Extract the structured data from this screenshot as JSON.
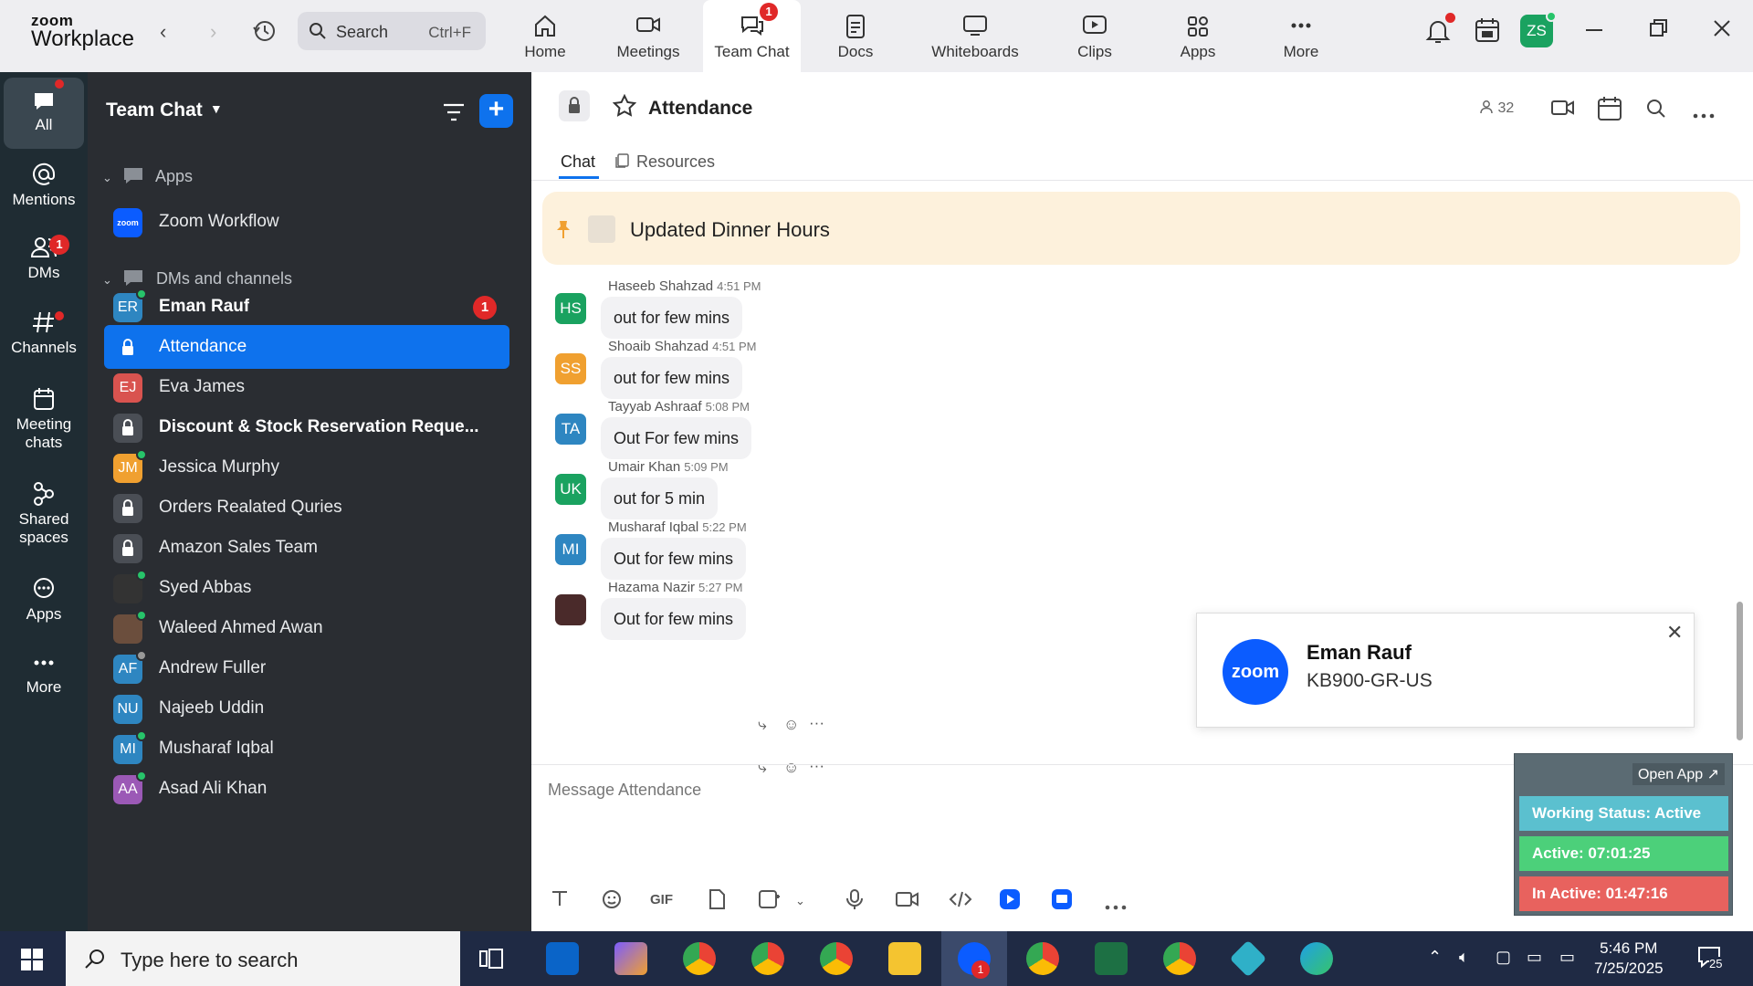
{
  "app": {
    "logo_line1": "zoom",
    "logo_line2": "Workplace"
  },
  "topbar": {
    "back_glyph": "‹",
    "forward_glyph": "›",
    "search": {
      "label": "Search",
      "shortcut": "Ctrl+F"
    },
    "tabs": [
      {
        "label": "Home",
        "icon": "home-icon"
      },
      {
        "label": "Meetings",
        "icon": "video-camera-icon"
      },
      {
        "label": "Team Chat",
        "icon": "chat-bubbles-icon",
        "badge": "1",
        "active": true
      },
      {
        "label": "Docs",
        "icon": "document-icon"
      },
      {
        "label": "Whiteboards",
        "icon": "whiteboard-icon"
      },
      {
        "label": "Clips",
        "icon": "clips-icon"
      },
      {
        "label": "Apps",
        "icon": "apps-grid-icon"
      },
      {
        "label": "More",
        "icon": "more-dots-icon"
      }
    ],
    "user_initials": "ZS"
  },
  "rail": {
    "items": [
      {
        "label": "All",
        "icon": "chat-icon",
        "active": true,
        "dot": true
      },
      {
        "label": "Mentions",
        "icon": "at-icon"
      },
      {
        "label": "DMs",
        "icon": "people-icon",
        "badge": "1"
      },
      {
        "label": "Channels",
        "icon": "hash-icon",
        "dot": true
      },
      {
        "label": "Meeting chats",
        "icon": "calendar-icon"
      },
      {
        "label": "Shared spaces",
        "icon": "shared-spaces-icon"
      },
      {
        "label": "Apps",
        "icon": "apps-chat-icon"
      },
      {
        "label": "More",
        "icon": "more-dots-icon"
      }
    ]
  },
  "panel": {
    "title": "Team Chat",
    "section_apps": "Apps",
    "zoom_workflow": {
      "label": "Zoom Workflow",
      "avatar": "zoom"
    },
    "section_dms": "DMs and channels",
    "rows": [
      {
        "name": "Eman Rauf",
        "initials": "ER",
        "color": "#2e86c1",
        "bold": true,
        "count": "1",
        "status": "online"
      },
      {
        "name": "Attendance",
        "locked": true,
        "selected": true
      },
      {
        "name": "Eva James",
        "initials": "EJ",
        "color": "#d9534f"
      },
      {
        "name": "Discount & Stock Reservation Reque...",
        "locked": true,
        "bold": true
      },
      {
        "name": "Jessica Murphy",
        "initials": "JM",
        "color": "#f0a030",
        "status": "online"
      },
      {
        "name": "Orders Realated Quries",
        "locked": true
      },
      {
        "name": "Amazon Sales Team",
        "locked": true
      },
      {
        "name": "Syed Abbas",
        "initials": "",
        "color": "#333",
        "status": "online"
      },
      {
        "name": "Waleed Ahmed Awan",
        "initials": "",
        "color": "#6b4e3d",
        "status": "online"
      },
      {
        "name": "Andrew Fuller",
        "initials": "AF",
        "color": "#2e86c1",
        "status": "away"
      },
      {
        "name": "Najeeb Uddin",
        "initials": "NU",
        "color": "#2e86c1"
      },
      {
        "name": "Musharaf Iqbal",
        "initials": "MI",
        "color": "#2e86c1",
        "status": "online"
      },
      {
        "name": "Asad Ali Khan",
        "initials": "AA",
        "color": "#9b59b6",
        "status": "online"
      }
    ]
  },
  "chat": {
    "title": "Attendance",
    "members": "32",
    "tabs": [
      "Chat",
      "Resources"
    ],
    "pinned": "Updated Dinner Hours",
    "messages": [
      {
        "sender": "Haseeb Shahzad",
        "time": "4:51 PM",
        "initials": "HS",
        "color": "#1aa260",
        "text": "out for few mins"
      },
      {
        "sender": "Shoaib Shahzad",
        "time": "4:51 PM",
        "initials": "SS",
        "color": "#f0a030",
        "text": "out for few mins"
      },
      {
        "sender": "Tayyab Ashraaf",
        "time": "5:08 PM",
        "initials": "TA",
        "color": "#2e86c1",
        "text": "Out For few mins"
      },
      {
        "sender": "Umair Khan",
        "time": "5:09 PM",
        "initials": "UK",
        "color": "#1aa260",
        "text": "out for 5 min"
      },
      {
        "sender": "Musharaf Iqbal",
        "time": "5:22 PM",
        "initials": "MI",
        "color": "#2e86c1",
        "text": "Out for few mins"
      },
      {
        "sender": "Hazama Nazir",
        "time": "5:27 PM",
        "initials": "",
        "color": "#4a2a2a",
        "text": "Out for few mins"
      }
    ],
    "compose_placeholder": "Message Attendance",
    "gif_label": "GIF"
  },
  "notification": {
    "logo": "zoom",
    "name": "Eman Rauf",
    "body": "KB900-GR-US"
  },
  "status_widget": {
    "open_app": "Open App ↗",
    "working": "Working Status: Active",
    "active": "Active: 07:01:25",
    "inactive": "In Active: 01:47:16",
    "colors": {
      "working": "#5bc0cf",
      "active": "#4cd07a",
      "inactive": "#e8625e"
    }
  },
  "taskbar": {
    "search_placeholder": "Type here to search",
    "time": "5:46 PM",
    "date": "7/25/2025",
    "notif_count": "25",
    "zoom_badge": "1"
  }
}
